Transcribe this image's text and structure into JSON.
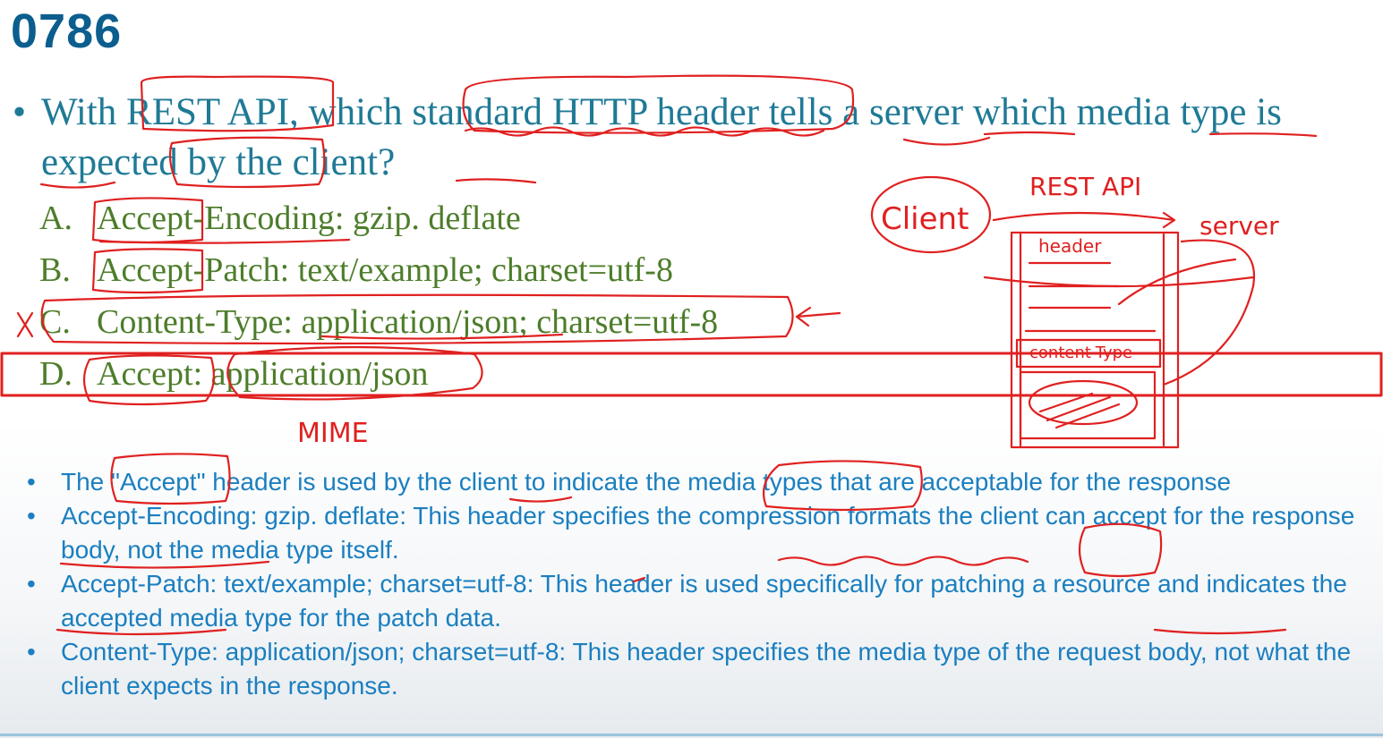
{
  "slide": {
    "number": "0786",
    "question": "With REST API, which standard HTTP header tells a server which media type is expected by the client?",
    "options": [
      {
        "letter": "A.",
        "text": "Accept-Encoding: gzip. deflate"
      },
      {
        "letter": "B.",
        "text": "Accept-Patch: text/example; charset=utf-8"
      },
      {
        "letter": "C.",
        "text": "Content-Type: application/json; charset=utf-8"
      },
      {
        "letter": "D.",
        "text": "Accept: application/json"
      }
    ],
    "correct_option": "D",
    "explanations": [
      {
        "text": "The \"Accept\" header is used by the client to indicate the media types that are acceptable for the response"
      },
      {
        "text": "Accept-Encoding: gzip. deflate: This header specifies the compression formats the client can accept for the response body, not the media type itself."
      },
      {
        "text": "Accept-Patch: text/example; charset=utf-8: This header is used specifically for patching a resource and indicates the accepted media type for the patch data."
      },
      {
        "text": "Content-Type: application/json; charset=utf-8: This header specifies the media type of the request body, not what the client expects in the response."
      }
    ]
  },
  "annotations": {
    "mime": "MIME",
    "rest_api": "REST API",
    "client": "Client",
    "server": "server",
    "header": "header",
    "content_type": "content-Type",
    "wrong_mark": "×",
    "color": "#e02020"
  },
  "colors": {
    "title": "#0b5e8e",
    "question": "#1f7a96",
    "options": "#4d7d2a",
    "explanations": "#1a7fc0",
    "highlight_box": "#e02020"
  }
}
